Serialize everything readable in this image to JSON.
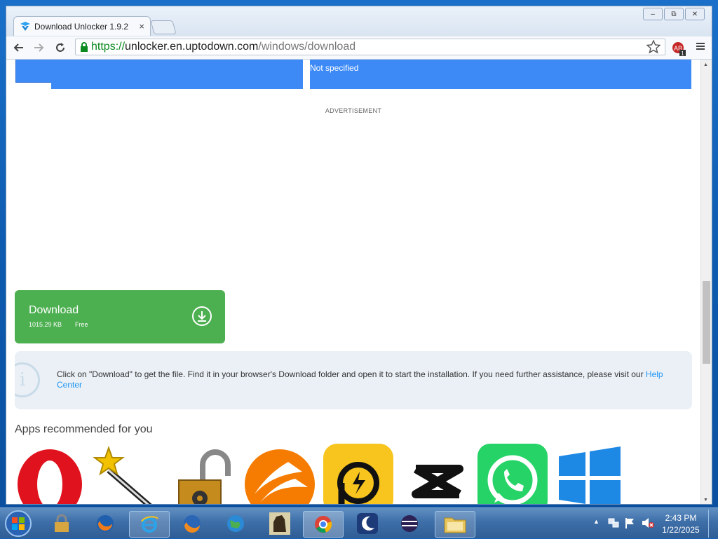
{
  "browser": {
    "tab_title": "Download Unlocker 1.9.2",
    "tab_close": "×",
    "url_scheme": "https://",
    "url_host": "unlocker.en.uptodown.com",
    "url_path": "/windows/download",
    "window_buttons": {
      "minimize": "–",
      "restore": "⧉",
      "close": "✕"
    },
    "extension_badge": "1"
  },
  "page": {
    "spec_value": "Not specified",
    "advertisement": "ADVERTISEMENT",
    "download": {
      "label": "Download",
      "size": "1015.29 KB",
      "price": "Free"
    },
    "info": {
      "text": "Click on \"Download\" to get the file. Find it in your browser's Download folder and open it to start the installation. If you need further assistance, please visit our ",
      "link": "Help Center"
    },
    "recommended_title": "Apps recommended for you",
    "apps": [
      "opera-logo",
      "magic-wand-icon",
      "unlocker-padlock-icon",
      "app-orange-icon",
      "ldplayer-icon",
      "capcut-icon",
      "whatsapp-icon",
      "windows-logo"
    ]
  },
  "taskbar": {
    "time": "2:43 PM",
    "date": "1/22/2025",
    "items": [
      "start",
      "security",
      "firefox",
      "ie",
      "firefox-alt",
      "globe",
      "horse",
      "chrome",
      "moon",
      "eclipse",
      "explorer"
    ]
  },
  "colors": {
    "accent_blue": "#3d8af7",
    "download_green": "#4caf50",
    "link": "#2196f3"
  }
}
